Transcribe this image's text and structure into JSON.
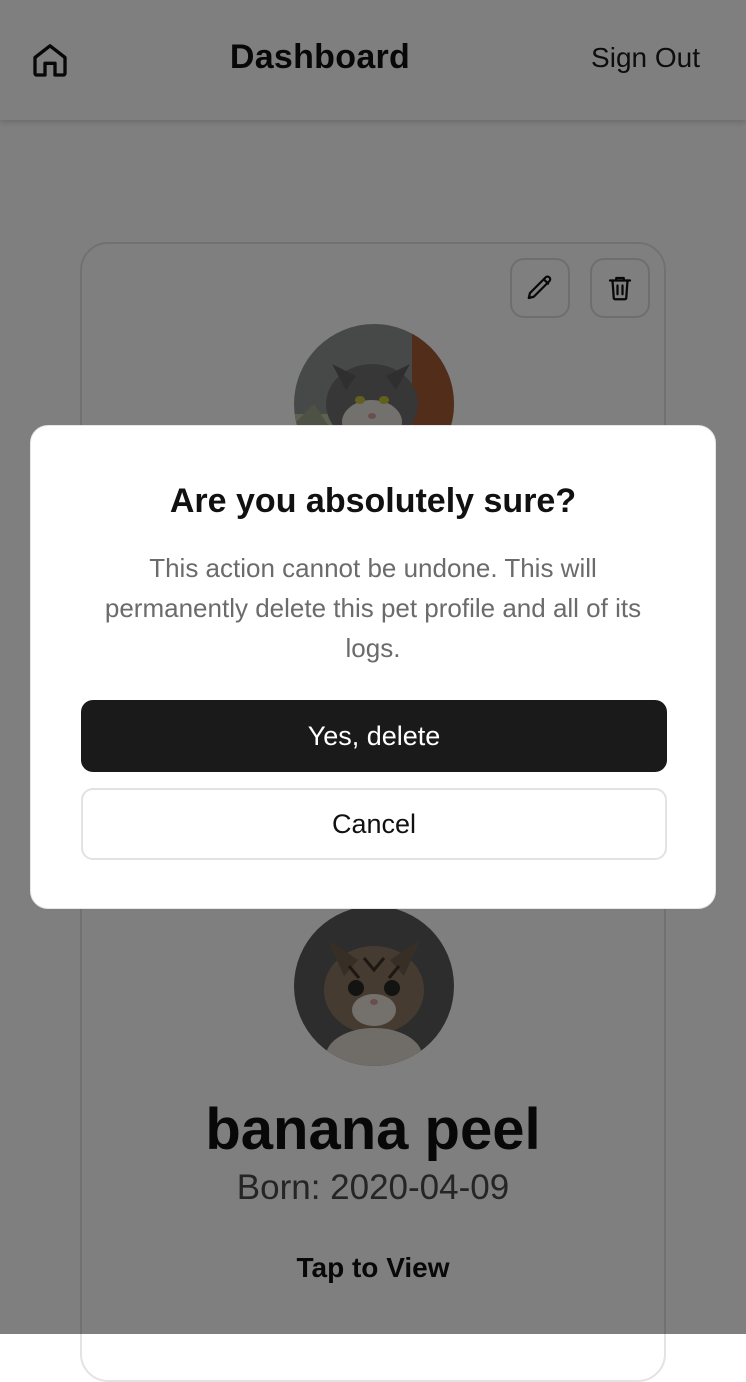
{
  "header": {
    "title": "Dashboard",
    "sign_out_label": "Sign Out",
    "home_icon": "home-icon"
  },
  "pet_card": {
    "edit_icon": "pencil-icon",
    "delete_icon": "trash-icon",
    "name": "banana peel",
    "born": "Born: 2020-04-09",
    "tap_label": "Tap to View"
  },
  "dialog": {
    "title": "Are you absolutely sure?",
    "description": "This action cannot be undone. This will permanently delete this pet profile and all of its logs.",
    "confirm_label": "Yes, delete",
    "cancel_label": "Cancel"
  },
  "colors": {
    "overlay": "#000000",
    "primary_button": "#1a1a1a",
    "text_muted": "#6b6b6b"
  }
}
